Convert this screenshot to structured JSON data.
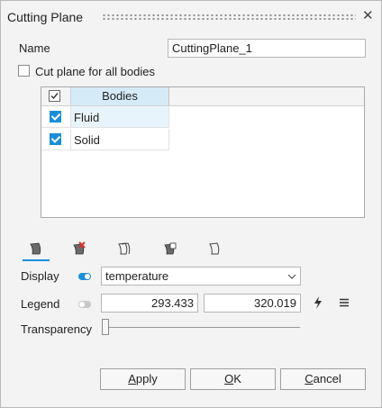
{
  "window": {
    "title": "Cutting Plane"
  },
  "name_row": {
    "label": "Name",
    "value": "CuttingPlane_1"
  },
  "all_bodies": {
    "label": "Cut plane for all bodies",
    "checked": false
  },
  "bodies_table": {
    "header": "Bodies",
    "rows": [
      {
        "label": "Fluid",
        "checked": true
      },
      {
        "label": "Solid",
        "checked": true
      }
    ]
  },
  "tabs": [
    {
      "icon": "plane-tab-icon",
      "active": true
    },
    {
      "icon": "plane-delete-tab-icon",
      "active": false
    },
    {
      "icon": "plane-stack-tab-icon",
      "active": false
    },
    {
      "icon": "plane-cube-tab-icon",
      "active": false
    },
    {
      "icon": "plane-outline-tab-icon",
      "active": false
    }
  ],
  "display": {
    "label": "Display",
    "value": "temperature",
    "toggle": true
  },
  "legend": {
    "label": "Legend",
    "min": "293.433",
    "max": "320.019",
    "toggle": false
  },
  "transparency": {
    "label": "Transparency",
    "level": 0
  },
  "buttons": {
    "apply_pre": "",
    "apply_u": "A",
    "apply_post": "pply",
    "ok_pre": "",
    "ok_u": "O",
    "ok_post": "K",
    "cancel_pre": "",
    "cancel_u": "C",
    "cancel_post": "ancel"
  },
  "colors": {
    "accent": "#1a8fd8",
    "selection": "#e8f4fc",
    "header_sel": "#d6ebf8"
  }
}
